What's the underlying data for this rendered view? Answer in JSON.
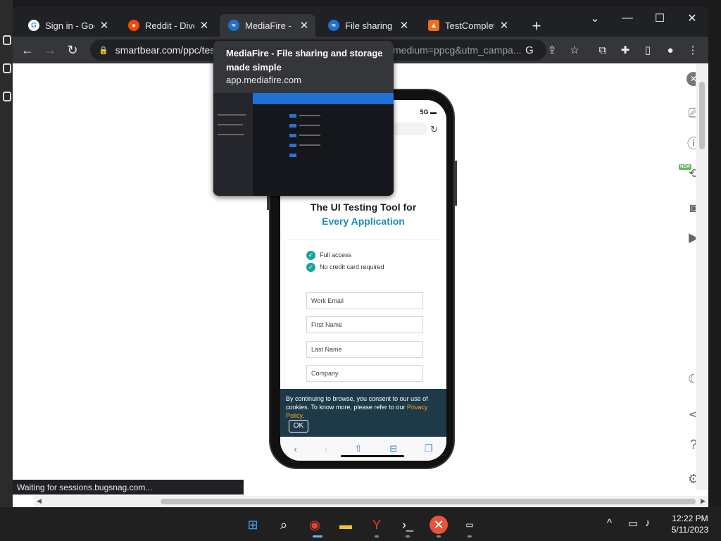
{
  "browser": {
    "tabs": [
      {
        "title": "Sign in - Goog",
        "icon": "google-icon",
        "active": false
      },
      {
        "title": "Reddit - Dive in",
        "icon": "reddit-icon",
        "active": false
      },
      {
        "title": "MediaFire - File",
        "icon": "mediafire-icon",
        "active": true
      },
      {
        "title": "File sharing an",
        "icon": "mediafire-icon",
        "active": false
      },
      {
        "title": "TestComplete",
        "icon": "smartbear-icon",
        "active": false
      }
    ],
    "url": "smartbear.com/ppc/tes",
    "url_tail": "medium=ppcg&utm_campa...",
    "status_text": "Waiting for sessions.bugsnag.com..."
  },
  "hovercard": {
    "title": "MediaFire - File sharing and storage made simple",
    "domain": "app.mediafire.com"
  },
  "phone": {
    "status": "5G",
    "hero_line1": "The UI Testing Tool for",
    "hero_line2": "Every Application",
    "checks": [
      "Full access",
      "No credit card required"
    ],
    "fields": [
      "Work Email",
      "First Name",
      "Last Name",
      "Company"
    ],
    "cookie_text": "By continuing to browse, you consent to our use of cookies. To know more, please refer to our ",
    "cookie_link": "Privacy Policy",
    "cookie_ok": "OK"
  },
  "rail": {
    "new_badge": "NEW"
  },
  "taskbar": {
    "time": "12:22 PM",
    "date": "5/11/2023"
  },
  "colors": {
    "accent": "#1d8fb8",
    "check_teal": "#17a59a",
    "cookie_bg": "#1e3a48",
    "privacy_link": "#f5a623"
  }
}
